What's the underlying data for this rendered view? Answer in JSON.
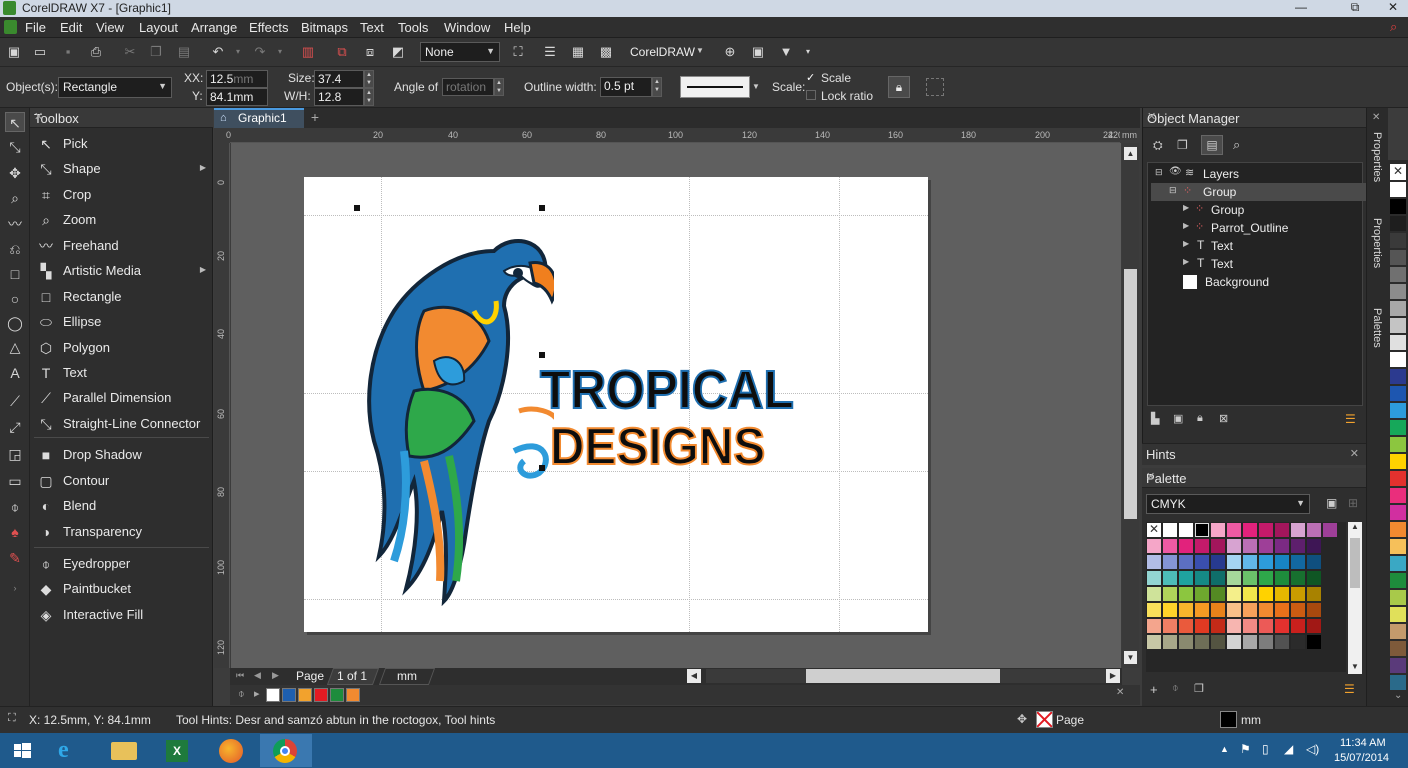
{
  "window": {
    "title": "CorelDRAW X7 - [Graphic1]",
    "minimize": "—",
    "restore": "⧉",
    "close": "✕"
  },
  "menu": [
    "File",
    "Edit",
    "View",
    "Layout",
    "Arrange",
    "Effects",
    "Bitmaps",
    "Text",
    "Tools",
    "Window",
    "Help"
  ],
  "toolbar": {
    "snap_value": "None",
    "launch_label": "CorelDRAW"
  },
  "propbar": {
    "objects_label": "Object(s):",
    "objects_value": "Rectangle",
    "x_label": "XX:",
    "x_value": "12.5",
    "x_unit": "mm",
    "y_label": "Y:",
    "y_value": "84.1mm",
    "size_label": "Size:",
    "size_value": "37.4",
    "wh_label": "W/H:",
    "wh_value": "12.8",
    "angle_label": "Angle of",
    "angle_placeholder": "rotation",
    "outline_label": "Outline width:",
    "outline_value": "0.5 pt",
    "scale_label": "Scale:",
    "scale_check": "Scale",
    "lock_ratio": "Lock ratio"
  },
  "toolbox": {
    "title": "Toolbox",
    "tools": [
      {
        "label": "Pick",
        "icon": "pointer-icon",
        "has_sub": false
      },
      {
        "label": "Shape",
        "icon": "shape-icon",
        "has_sub": true
      },
      {
        "label": "Crop",
        "icon": "crop-icon",
        "has_sub": false
      },
      {
        "label": "Zoom",
        "icon": "zoom-icon",
        "has_sub": false
      },
      {
        "label": "Freehand",
        "icon": "freehand-icon",
        "has_sub": false
      },
      {
        "label": "Artistic Media",
        "icon": "artistic-media-icon",
        "has_sub": true
      },
      {
        "label": "Rectangle",
        "icon": "rectangle-icon",
        "has_sub": false
      },
      {
        "label": "Ellipse",
        "icon": "ellipse-icon",
        "has_sub": false
      },
      {
        "label": "Polygon",
        "icon": "polygon-icon",
        "has_sub": false
      },
      {
        "label": "Text",
        "icon": "text-icon",
        "has_sub": false
      },
      {
        "label": "Parallel Dimension",
        "icon": "dimension-icon",
        "has_sub": false
      },
      {
        "label": "Straight-Line Connector",
        "icon": "connector-icon",
        "has_sub": false
      },
      {
        "label": "Drop Shadow",
        "icon": "drop-shadow-icon",
        "has_sub": false
      },
      {
        "label": "Contour",
        "icon": "contour-icon",
        "has_sub": false
      },
      {
        "label": "Blend",
        "icon": "blend-icon",
        "has_sub": false
      },
      {
        "label": "Transparency",
        "icon": "transparency-icon",
        "has_sub": false
      },
      {
        "label": "Eyedropper",
        "icon": "eyedropper-icon",
        "has_sub": false
      },
      {
        "label": "Paintbucket",
        "icon": "paintbucket-icon",
        "has_sub": false
      },
      {
        "label": "Interactive Fill",
        "icon": "interactive-fill-icon",
        "has_sub": false
      }
    ]
  },
  "document": {
    "tab": "Graphic1",
    "ruler_unit": "mm",
    "h_ticks": [
      "0",
      "20",
      "40",
      "60",
      "80",
      "100",
      "120",
      "140",
      "160",
      "180",
      "200",
      "220",
      "24"
    ],
    "v_ticks": [
      "0",
      "20",
      "40",
      "60",
      "80",
      "100",
      "120"
    ],
    "logo_line1": "TROPICAL",
    "logo_line2": "DESIGNS",
    "page_label": "Page",
    "page_count": "1 of 1",
    "unit_tab": "mm"
  },
  "object_manager": {
    "title": "Object Manager",
    "items": [
      {
        "label": "Layers",
        "indent": 0,
        "icon": "layers-icon"
      },
      {
        "label": "Group",
        "indent": 1,
        "icon": "group-icon"
      },
      {
        "label": "Group",
        "indent": 2,
        "icon": "group-icon"
      },
      {
        "label": "Parrot_Outline",
        "indent": 2,
        "icon": "group-icon"
      },
      {
        "label": "Text",
        "indent": 2,
        "icon": "text-icon"
      },
      {
        "label": "Text",
        "indent": 2,
        "icon": "text-icon"
      },
      {
        "label": "Background",
        "indent": 1,
        "icon": "white-swatch-icon"
      }
    ]
  },
  "hints": {
    "title": "Hints"
  },
  "palette": {
    "title": "Palette",
    "name": "CMYK",
    "colors": [
      "#f5a6c8",
      "#ee5aa3",
      "#e2227c",
      "#c41a6a",
      "#a3165c",
      "#d7a3d1",
      "#bb6fb5",
      "#9e3f98",
      "#7b2a84",
      "#5e1f6d",
      "#3e1655",
      "#b2bde6",
      "#8495d4",
      "#5c6fc2",
      "#3a4fae",
      "#273a8f",
      "#a4d4f2",
      "#62b7e8",
      "#2d9cdb",
      "#1784c2",
      "#1268a0",
      "#0f4f7e",
      "#93d5d2",
      "#4dbcb8",
      "#1fa39f",
      "#158985",
      "#0f6e6a",
      "#a6d89b",
      "#6bc16a",
      "#2ea84a",
      "#1e8c3c",
      "#17702f",
      "#0f5624",
      "#cfe39a",
      "#b0d35a",
      "#8cc63f",
      "#6ea82e",
      "#548a23",
      "#f4ef8a",
      "#f2e64b",
      "#ffd200",
      "#e6b800",
      "#c99c00",
      "#a88200",
      "#f9e05a",
      "#ffd42a",
      "#f7b52c",
      "#f59a23",
      "#e8821a",
      "#f8c089",
      "#f6a15b",
      "#f28a30",
      "#e8711a",
      "#cc5c12",
      "#a8490e",
      "#f4a58d",
      "#f07f64",
      "#ea5a3c",
      "#e03a22",
      "#c42a18",
      "#f7b5b0",
      "#f28a85",
      "#ec5a57",
      "#e3312e",
      "#c9201d",
      "#a11815",
      "#c7c7a6",
      "#a8a889",
      "#8a8a6f",
      "#6e6e57",
      "#545441",
      "#d3d3d3",
      "#a8a8a8",
      "#7d7d7d",
      "#525252",
      "#2b2b2b",
      "#000000"
    ]
  },
  "side_tabs": [
    "Properties",
    "Properties",
    "Palettes"
  ],
  "right_strip_colors": [
    "#ffffff",
    "#000000",
    "#1e1e1e",
    "#3a3a3a",
    "#555555",
    "#707070",
    "#8c8c8c",
    "#a8a8a8",
    "#c4c4c4",
    "#e0e0e0",
    "#ffffff",
    "#2c3a8f",
    "#1d56b0",
    "#2d9cdb",
    "#16a85a",
    "#8cc63f",
    "#ffd200",
    "#e3312e",
    "#ea2e7c",
    "#d12fa0",
    "#f28a30",
    "#f6c05a",
    "#3aa8c4",
    "#1e8c3c",
    "#a8c94a",
    "#e0e05a",
    "#c49a6c",
    "#7e5a3a",
    "#5a3a7a",
    "#2a6a8a"
  ],
  "bottom_strip_colors": [
    "#ffffff",
    "#1e5fb0",
    "#f2a22d",
    "#e31b23",
    "#1e8c3c",
    "#f28a30"
  ],
  "status": {
    "coords": "X: 12.5mm, Y: 84.1mm",
    "hint": "Tool Hints: Desr and samzó abtun in the roctogox, Tool hints",
    "fill_label": "Page",
    "outline_unit": "mm"
  },
  "taskbar": {
    "time": "11:34 AM",
    "date": "15/07/2014"
  }
}
